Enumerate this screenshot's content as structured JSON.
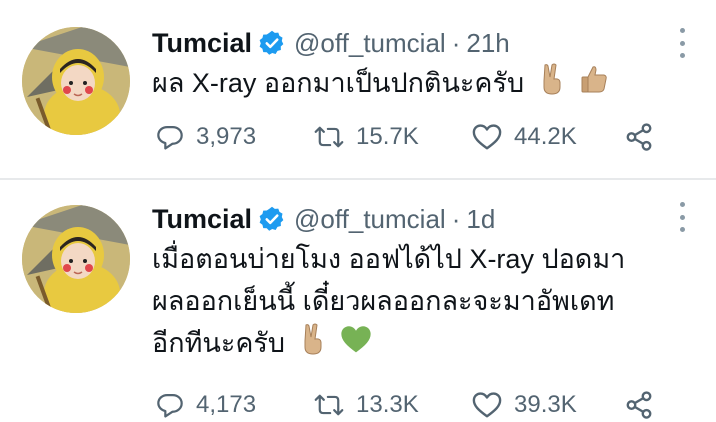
{
  "tweets": [
    {
      "name": "Tumcial",
      "handle": "@off_tumcial",
      "separator": "·",
      "time": "21h",
      "text_lines": [
        "ผล X-ray ออกมาเป็นปกตินะครับ"
      ],
      "emojis": [
        "victory-hand-emoji",
        "thumbs-up-emoji"
      ],
      "replies": "3,973",
      "retweets": "15.7K",
      "likes": "44.2K"
    },
    {
      "name": "Tumcial",
      "handle": "@off_tumcial",
      "separator": "·",
      "time": "1d",
      "text_lines": [
        "เมื่อตอนบ่ายโมง ออฟได้ไป X-ray ปอดมา",
        "ผลออกเย็นนี้ เดี๋ยวผลออกละจะมาอัพเดท",
        "อีกทีนะครับ"
      ],
      "emojis": [
        "victory-hand-emoji",
        "green-heart-emoji"
      ],
      "replies": "4,173",
      "retweets": "13.3K",
      "likes": "39.3K"
    }
  ],
  "colors": {
    "text": "#0f1419",
    "secondary": "#536471",
    "verified": "#1d9bf0",
    "divider": "#e7e9eb"
  }
}
